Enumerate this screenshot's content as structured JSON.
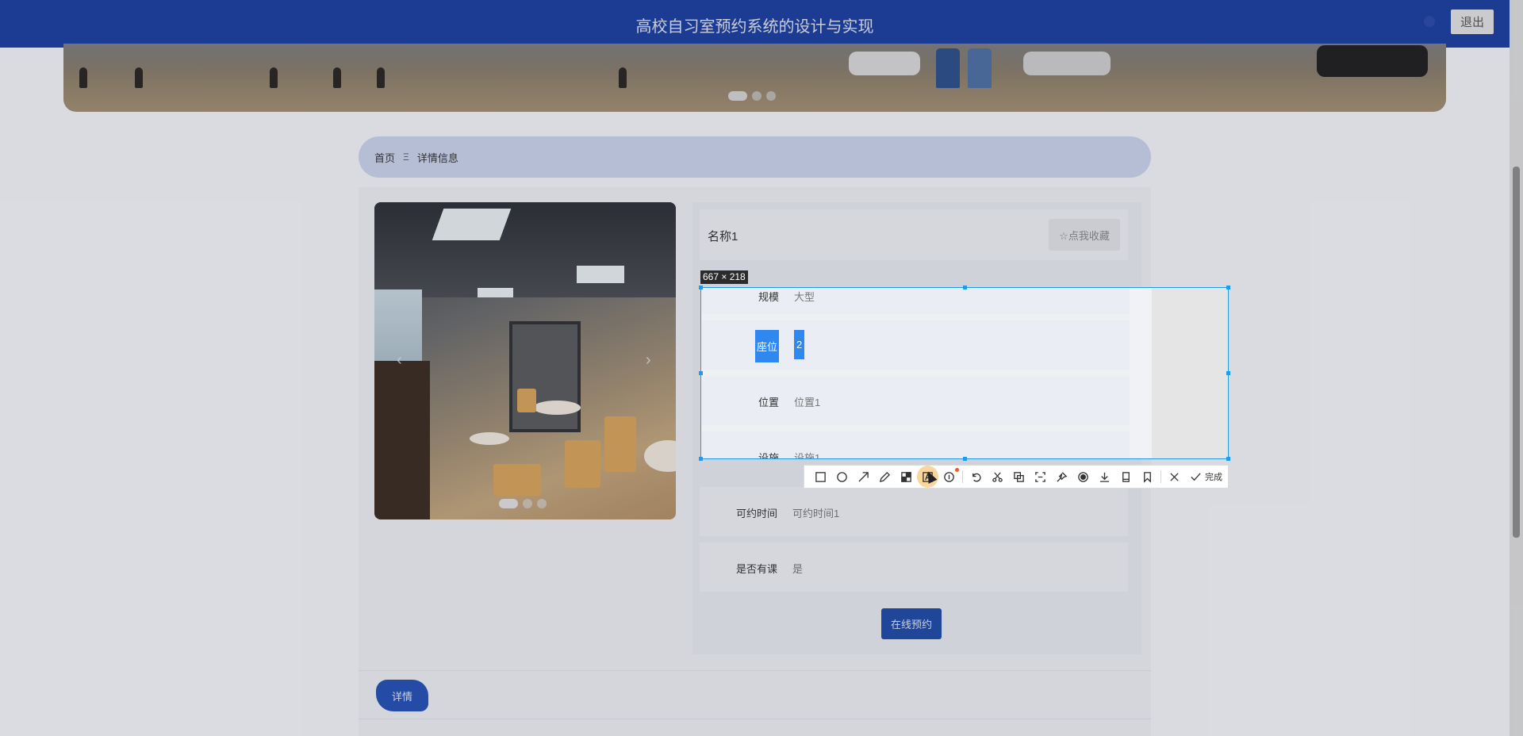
{
  "header": {
    "title": "高校自习室预约系统的设计与实现",
    "logout_label": "退出"
  },
  "breadcrumb": {
    "home": "首页",
    "separator": "Ξ",
    "current": "详情信息"
  },
  "room": {
    "name": "名称1",
    "favorite_label": "☆点我收藏",
    "fields": [
      {
        "label": "规模",
        "value": "大型"
      },
      {
        "label": "座位",
        "value": "2"
      },
      {
        "label": "位置",
        "value": "位置1"
      },
      {
        "label": "设施",
        "value": "设施1"
      },
      {
        "label": "可约时间",
        "value": "可约时间1"
      },
      {
        "label": "是否有课",
        "value": "是"
      }
    ],
    "book_label": "在线预约"
  },
  "detail_tab": {
    "label": "详情"
  },
  "capture": {
    "size_label": "667 × 218",
    "done_label": "完成"
  },
  "colors": {
    "header_bg": "#1b3e9f",
    "accent": "#1f4aa8",
    "selection_border": "#1f9bea",
    "highlight": "#2f87f0"
  }
}
